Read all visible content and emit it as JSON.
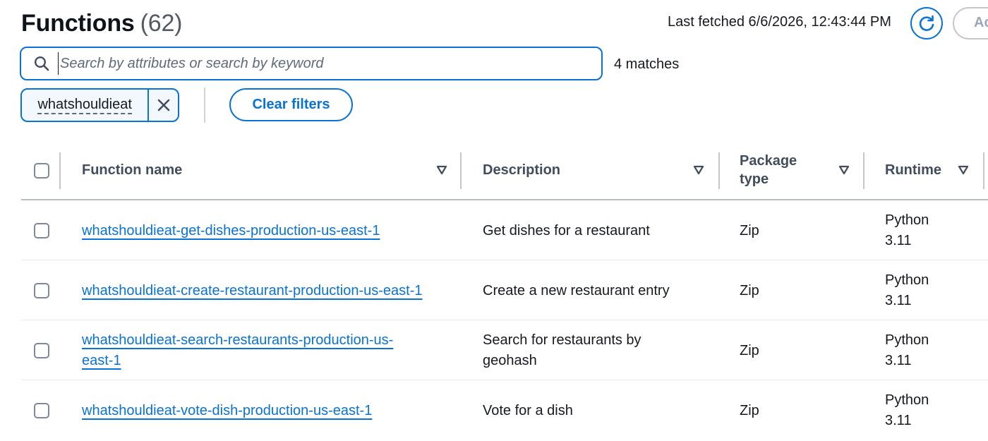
{
  "header": {
    "title": "Functions",
    "count": "(62)",
    "last_fetched": "Last fetched 6/6/2026, 12:43:44 PM",
    "add_button_label": "Ac"
  },
  "search": {
    "placeholder": "Search by attributes or search by keyword",
    "matches": "4 matches"
  },
  "filters": {
    "token_label": "whatshouldieat",
    "clear_label": "Clear filters"
  },
  "table": {
    "columns": [
      {
        "label": "Function name"
      },
      {
        "label": "Description"
      },
      {
        "label": "Package type"
      },
      {
        "label": "Runtime"
      }
    ],
    "rows": [
      {
        "name": "whatshouldieat-get-dishes-production-us-east-1",
        "description": "Get dishes for a restaurant",
        "package": "Zip",
        "runtime": "Python 3.11"
      },
      {
        "name": "whatshouldieat-create-restaurant-production-us-east-1",
        "description": "Create a new restaurant entry",
        "package": "Zip",
        "runtime": "Python 3.11"
      },
      {
        "name": "whatshouldieat-search-restaurants-production-us-east-1",
        "description": "Search for restaurants by geohash",
        "package": "Zip",
        "runtime": "Python 3.11"
      },
      {
        "name": "whatshouldieat-vote-dish-production-us-east-1",
        "description": "Vote for a dish",
        "package": "Zip",
        "runtime": "Python 3.11"
      }
    ]
  },
  "colors": {
    "accent": "#0972d3",
    "text": "#16191f",
    "header_text": "#414d5c",
    "muted": "#545b64"
  },
  "icons": [
    "search-icon",
    "refresh-icon",
    "close-icon",
    "sort-caret-icon"
  ]
}
